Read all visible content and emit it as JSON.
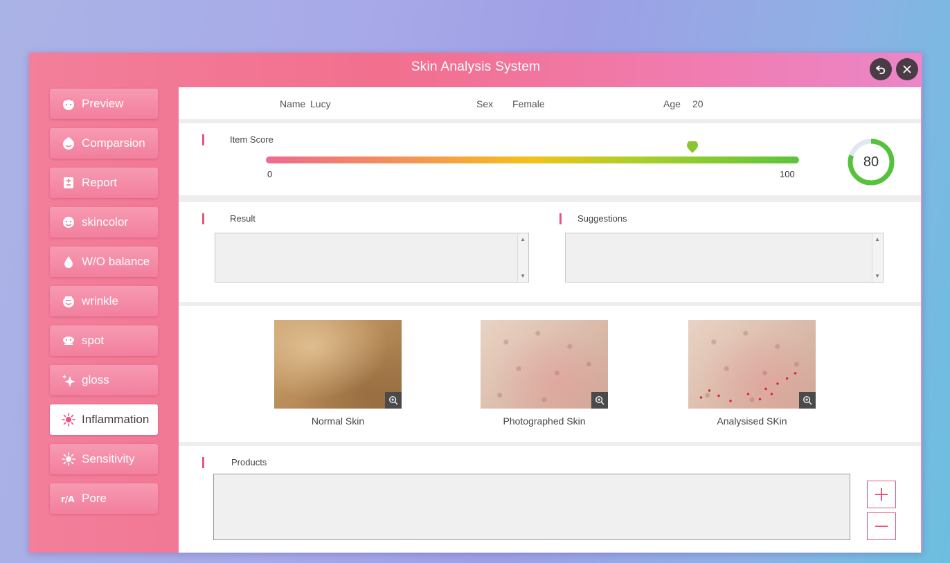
{
  "window": {
    "title": "Skin Analysis System",
    "back_icon": "undo-icon",
    "close_icon": "close-icon"
  },
  "sidebar": {
    "items": [
      {
        "label": "Preview",
        "icon": "face-icon",
        "active": false
      },
      {
        "label": "Comparsion",
        "icon": "face-compare-icon",
        "active": false
      },
      {
        "label": "Report",
        "icon": "report-icon",
        "active": false
      },
      {
        "label": "skincolor",
        "icon": "skincolor-icon",
        "active": false
      },
      {
        "label": "W/O balance",
        "icon": "water-drop-icon",
        "active": false
      },
      {
        "label": "wrinkle",
        "icon": "wrinkle-icon",
        "active": false
      },
      {
        "label": "spot",
        "icon": "spot-icon",
        "active": false
      },
      {
        "label": "gloss",
        "icon": "sparkle-icon",
        "active": false
      },
      {
        "label": "Inflammation",
        "icon": "inflammation-icon",
        "active": true
      },
      {
        "label": "Sensitivity",
        "icon": "sensitivity-icon",
        "active": false
      },
      {
        "label": "Pore",
        "icon": "pore-icon",
        "active": false
      }
    ]
  },
  "patient": {
    "name_label": "Name",
    "name": "Lucy",
    "sex_label": "Sex",
    "sex": "Female",
    "age_label": "Age",
    "age": "20"
  },
  "score": {
    "title": "Item Score",
    "min": "0",
    "max": "100",
    "value": "80",
    "marker_fraction": 0.8
  },
  "result": {
    "title": "Result",
    "text": ""
  },
  "suggestions": {
    "title": "Suggestions",
    "text": ""
  },
  "images": [
    {
      "label": "Normal Skin"
    },
    {
      "label": "Photographed Skin"
    },
    {
      "label": "Analysised SKin"
    }
  ],
  "products": {
    "title": "Products",
    "text": "",
    "add_icon": "plus-icon",
    "remove_icon": "minus-icon"
  },
  "colors": {
    "accent": "#e8557c",
    "gauge_green": "#55c23b",
    "window_pink": "#f26f8e"
  }
}
